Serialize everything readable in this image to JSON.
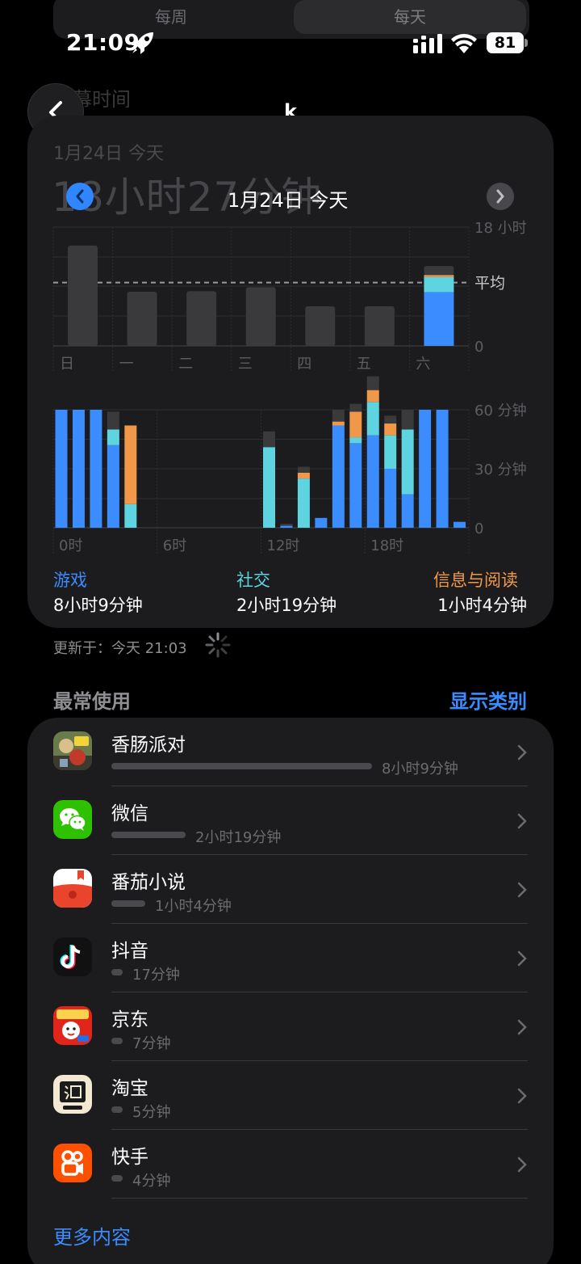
{
  "tabs": {
    "week": "每周",
    "day": "每天"
  },
  "status": {
    "time": "21:09",
    "battery": "81"
  },
  "nav": {
    "title": "k",
    "ghost_title": "屏幕时间"
  },
  "summary": {
    "date": "1月24日 今天",
    "total": "18小时27分钟",
    "date_nav": "1月24日 今天"
  },
  "chart_data": [
    {
      "type": "bar",
      "title": "",
      "categories": [
        "日",
        "一",
        "二",
        "三",
        "四",
        "五",
        "六"
      ],
      "series": [
        {
          "name": "",
          "values": [
            15.2,
            8.2,
            8.3,
            8.9,
            6.0,
            6.0,
            11.5
          ]
        }
      ],
      "highlight_breakdown": {
        "category": "六",
        "游戏": 8.15,
        "社交": 2.3,
        "信息与阅读": 0.3,
        "其他": 1.35
      },
      "ylim": [
        0,
        18
      ],
      "yticks": [
        "0",
        "平均",
        "18 小时"
      ],
      "average": 9.6,
      "grid": true
    },
    {
      "type": "bar",
      "title": "",
      "categories": [
        "0时",
        "1",
        "2",
        "3",
        "4",
        "5",
        "6时",
        "7",
        "8",
        "9",
        "10",
        "11",
        "12时",
        "13",
        "14",
        "15",
        "16",
        "17",
        "18时",
        "19",
        "20",
        "21",
        "22",
        "23"
      ],
      "series": [
        {
          "name": "游戏",
          "values": [
            60,
            60,
            60,
            42,
            0,
            0,
            0,
            0,
            0,
            0,
            0,
            0,
            0,
            1,
            0,
            5,
            52,
            43,
            47,
            30,
            17,
            60,
            60,
            3
          ]
        },
        {
          "name": "社交",
          "values": [
            0,
            0,
            0,
            8,
            12,
            0,
            0,
            0,
            0,
            0,
            0,
            0,
            41,
            0,
            25,
            0,
            0,
            3,
            17,
            17,
            33,
            0,
            0,
            0
          ]
        },
        {
          "name": "信息与阅读",
          "values": [
            0,
            0,
            0,
            0,
            40,
            0,
            0,
            0,
            0,
            0,
            0,
            0,
            0,
            0,
            3,
            0,
            2,
            13,
            6,
            6,
            0,
            0,
            0,
            0
          ]
        },
        {
          "name": "其他",
          "values": [
            0,
            0,
            0,
            9,
            0,
            0,
            0,
            0,
            0,
            0,
            0,
            0,
            8,
            1,
            3,
            0,
            6,
            4,
            7,
            4,
            10,
            0,
            0,
            0
          ]
        }
      ],
      "ylim": [
        0,
        60
      ],
      "yticks": [
        "0",
        "30 分钟",
        "60 分钟"
      ],
      "xticks": [
        "0时",
        "6时",
        "12时",
        "18时"
      ],
      "grid": true
    }
  ],
  "legend": [
    {
      "name": "游戏",
      "value": "8小时9分钟",
      "color": "#3a8cff"
    },
    {
      "name": "社交",
      "value": "2小时19分钟",
      "color": "#5ed4e0"
    },
    {
      "name": "信息与阅读",
      "value": "1小时4分钟",
      "color": "#f0974a"
    }
  ],
  "updated": "更新于：今天 21:03",
  "most_used": {
    "title": "最常使用",
    "link": "显示类别"
  },
  "apps": [
    {
      "name": "香肠派对",
      "time": "8小时9分钟",
      "fraction": 1.0,
      "icon": "sausage-party-icon"
    },
    {
      "name": "微信",
      "time": "2小时19分钟",
      "fraction": 0.284,
      "icon": "wechat-icon"
    },
    {
      "name": "番茄小说",
      "time": "1小时4分钟",
      "fraction": 0.131,
      "icon": "tomato-novel-icon"
    },
    {
      "name": "抖音",
      "time": "17分钟",
      "fraction": 0.035,
      "icon": "douyin-icon"
    },
    {
      "name": "京东",
      "time": "7分钟",
      "fraction": 0.014,
      "icon": "jd-icon"
    },
    {
      "name": "淘宝",
      "time": "5分钟",
      "fraction": 0.01,
      "icon": "taobao-icon"
    },
    {
      "name": "快手",
      "time": "4分钟",
      "fraction": 0.008,
      "icon": "kuaishou-icon"
    }
  ],
  "more": "更多内容"
}
